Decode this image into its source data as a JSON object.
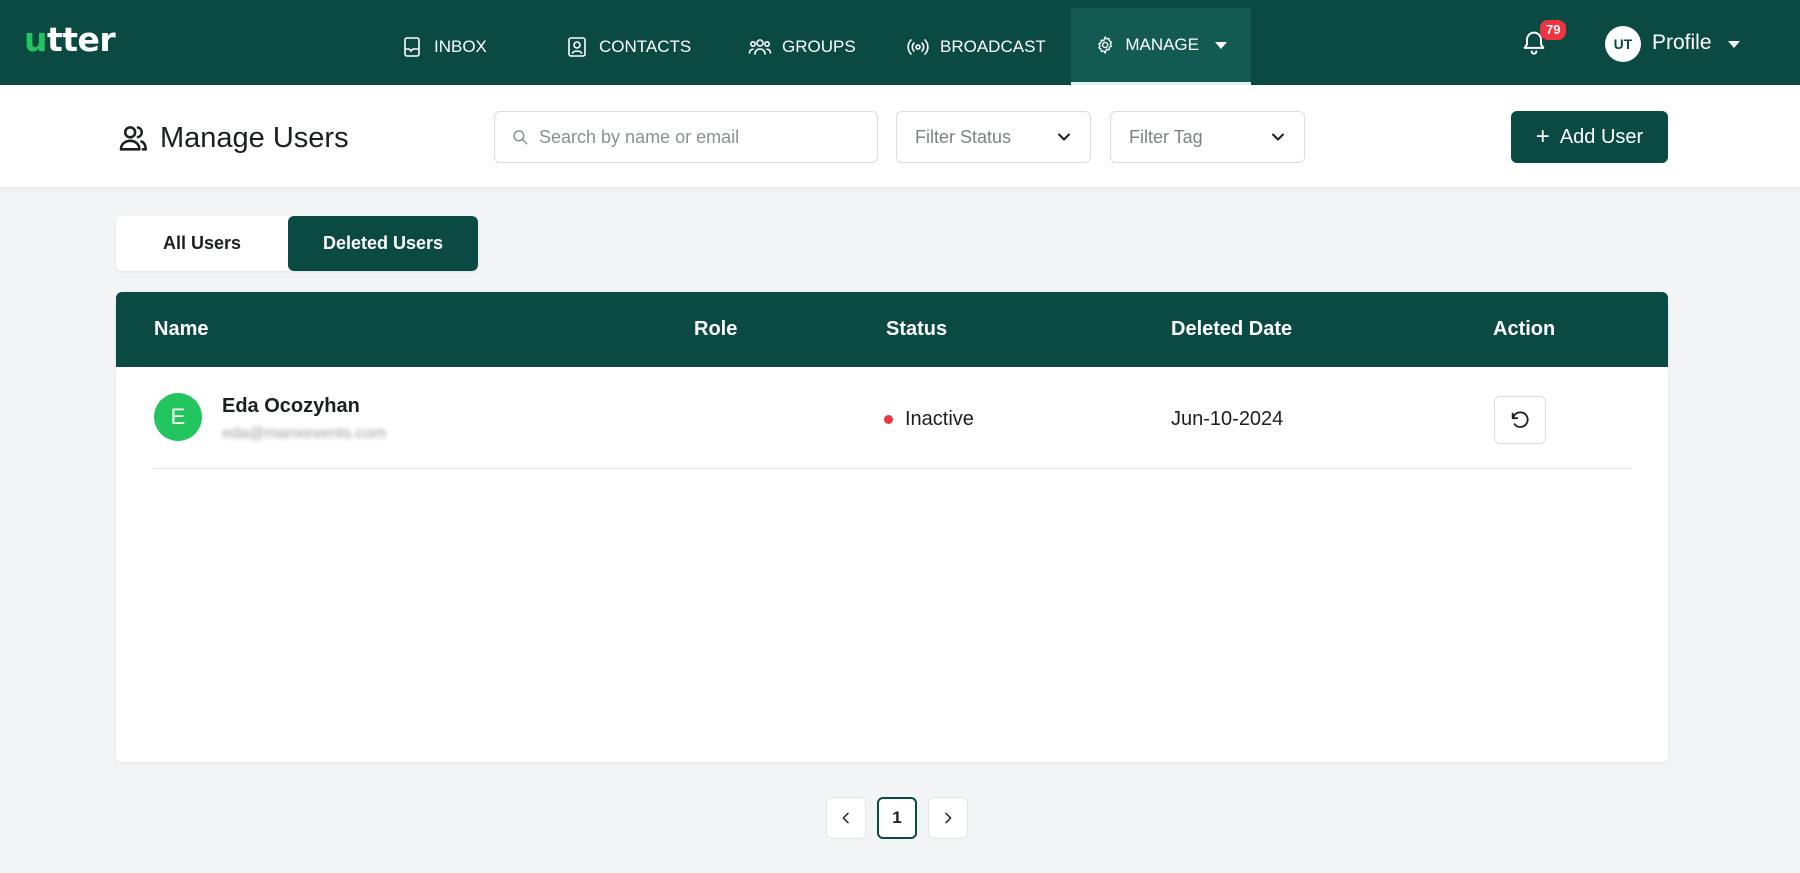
{
  "app": {
    "logo_first": "u",
    "logo_rest": "tter"
  },
  "nav": {
    "items": [
      {
        "label": "INBOX",
        "icon": "inbox-icon"
      },
      {
        "label": "CONTACTS",
        "icon": "contacts-icon"
      },
      {
        "label": "GROUPS",
        "icon": "groups-icon"
      },
      {
        "label": "BROADCAST",
        "icon": "broadcast-icon"
      },
      {
        "label": "MANAGE",
        "icon": "gear-icon"
      }
    ],
    "active": "MANAGE",
    "notification_count": "79",
    "profile_initials": "UT",
    "profile_label": "Profile"
  },
  "toolbar": {
    "title": "Manage Users",
    "search_placeholder": "Search by name or email",
    "filter_status": "Filter Status",
    "filter_tag": "Filter Tag",
    "add_label": "Add User"
  },
  "tabs": {
    "all": "All Users",
    "deleted": "Deleted Users",
    "active": "Deleted Users"
  },
  "table": {
    "columns": [
      "Name",
      "Role",
      "Status",
      "Deleted Date",
      "Action"
    ],
    "rows": [
      {
        "initial": "E",
        "name": "Eda Ocozyhan",
        "email": "eda@manxevents.com",
        "role": "",
        "status": "Inactive",
        "deleted_date": "Jun-10-2024"
      }
    ]
  },
  "pagination": {
    "current": "1"
  },
  "colors": {
    "primary": "#0b4a43",
    "accent_green": "#22c55e",
    "badge_red": "#ef3340",
    "inactive_dot": "#ef3340"
  }
}
